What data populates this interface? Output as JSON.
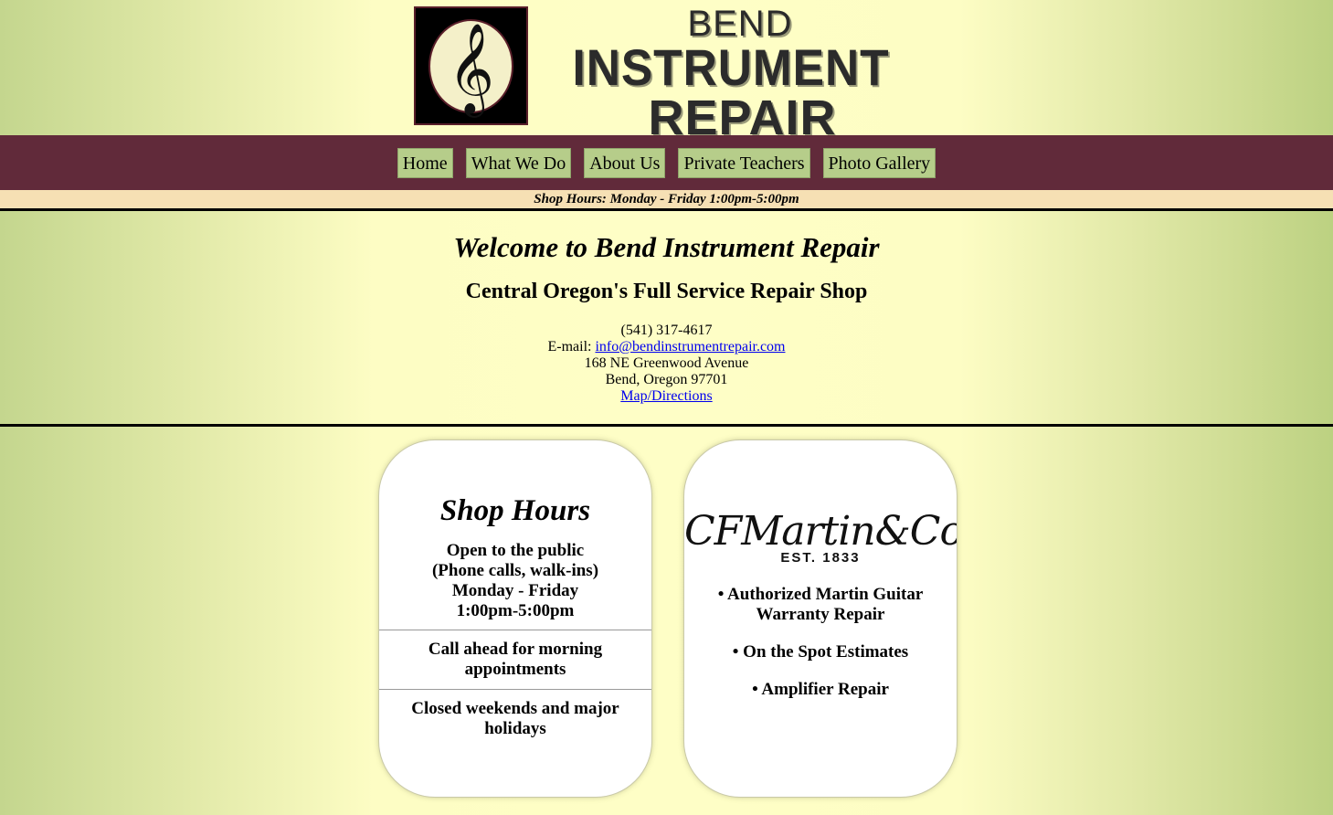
{
  "logo": {
    "line1": "BEND",
    "line2": "INSTRUMENT",
    "line3": "REPAIR",
    "icon": "treble-clef-icon"
  },
  "nav": {
    "items": [
      {
        "label": "Home"
      },
      {
        "label": "What We Do"
      },
      {
        "label": "About Us"
      },
      {
        "label": "Private Teachers"
      },
      {
        "label": "Photo Gallery"
      }
    ]
  },
  "hours_bar": "Shop Hours: Monday - Friday 1:00pm-5:00pm",
  "welcome": {
    "title": "Welcome to Bend Instrument Repair",
    "subtitle": "Central Oregon's Full Service Repair Shop",
    "phone": "(541) 317-4617",
    "email_label": "E-mail:",
    "email": "info@bendinstrumentrepair.com",
    "address1": "168 NE Greenwood Avenue",
    "address2": "Bend, Oregon 97701",
    "map_link": "Map/Directions"
  },
  "hours_card": {
    "title": "Shop Hours",
    "line1": "Open to the public",
    "line2": "(Phone calls, walk-ins)",
    "line3": "Monday - Friday",
    "line4": "1:00pm-5:00pm",
    "note": "Call ahead for morning appointments",
    "closed": "Closed weekends and major holidays"
  },
  "martin_card": {
    "logo_text": "CFMartin&Co.",
    "logo_est": "EST. 1833",
    "services": [
      "• Authorized Martin Guitar Warranty Repair",
      "• On the Spot Estimates",
      "• Amplifier Repair"
    ]
  },
  "colors": {
    "nav_bg": "#612a3a",
    "nav_button": "#b6cd8a",
    "hours_bar_bg": "#f6e0b4",
    "link": "#0000ee"
  }
}
